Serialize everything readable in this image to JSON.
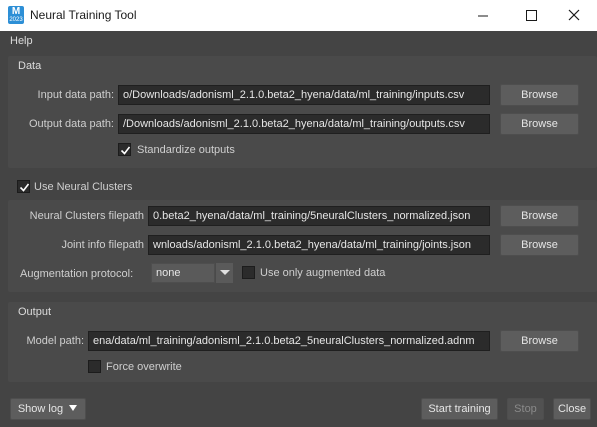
{
  "window": {
    "title": "Neural Training Tool",
    "icon_letter": "M",
    "icon_sub": "2023"
  },
  "menu": {
    "help": "Help"
  },
  "data_section": {
    "title": "Data",
    "input_label": "Input data path:",
    "input_value": "o/Downloads/adonisml_2.1.0.beta2_hyena/data/ml_training/inputs.csv",
    "output_label": "Output data path:",
    "output_value": "/Downloads/adonisml_2.1.0.beta2_hyena/data/ml_training/outputs.csv",
    "browse": "Browse",
    "standardize_label": "Standardize outputs",
    "standardize_checked": true
  },
  "clusters_section": {
    "enable_label": "Use Neural Clusters",
    "enable_checked": true,
    "clusters_label": "Neural Clusters filepath",
    "clusters_value": "0.beta2_hyena/data/ml_training/5neuralClusters_normalized.json",
    "joint_label": "Joint info filepath",
    "joint_value": "wnloads/adonisml_2.1.0.beta2_hyena/data/ml_training/joints.json",
    "browse": "Browse",
    "augmentation_label": "Augmentation protocol:",
    "augmentation_value": "none",
    "augmented_only_label": "Use only augmented data",
    "augmented_only_checked": false
  },
  "output_section": {
    "title": "Output",
    "model_label": "Model path:",
    "model_value": "ena/data/ml_training/adonisml_2.1.0.beta2_5neuralClusters_normalized.adnm",
    "browse": "Browse",
    "force_label": "Force overwrite",
    "force_checked": false
  },
  "footer": {
    "show_log": "Show log",
    "start": "Start training",
    "stop": "Stop",
    "close": "Close"
  },
  "colors": {
    "background": "#444444",
    "group_background": "#4a4a4a",
    "field_background": "#2b2b2b",
    "button_background": "#5d5d5d",
    "icon_accent": "#2d8fd6"
  }
}
